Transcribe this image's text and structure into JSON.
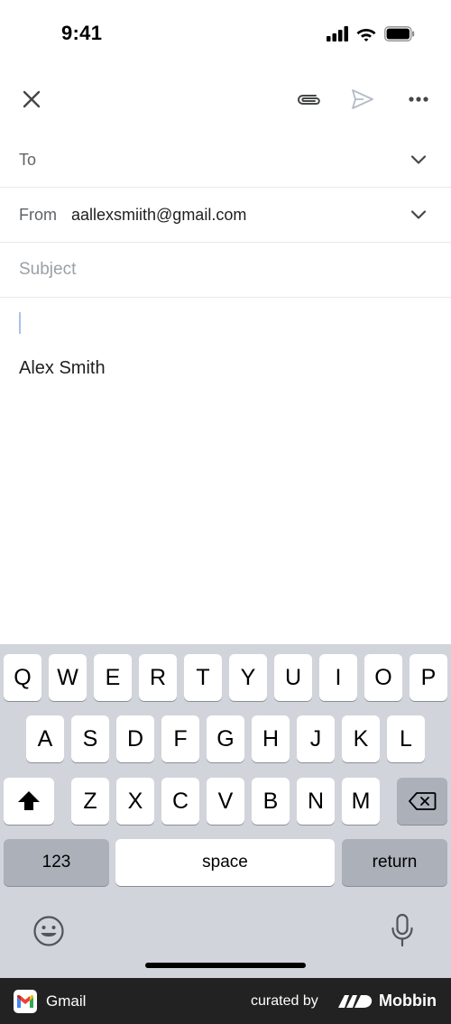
{
  "status_bar": {
    "time": "9:41"
  },
  "compose": {
    "to_label": "To",
    "from_label": "From",
    "from_value": "aallexsmiith@gmail.com",
    "subject_placeholder": "Subject",
    "signature": "Alex Smith"
  },
  "keyboard": {
    "row1": [
      "Q",
      "W",
      "E",
      "R",
      "T",
      "Y",
      "U",
      "I",
      "O",
      "P"
    ],
    "row2": [
      "A",
      "S",
      "D",
      "F",
      "G",
      "H",
      "J",
      "K",
      "L"
    ],
    "row3": [
      "Z",
      "X",
      "C",
      "V",
      "B",
      "N",
      "M"
    ],
    "numbers_label": "123",
    "space_label": "space",
    "return_label": "return"
  },
  "footer": {
    "app_name": "Gmail",
    "curated_by": "curated by",
    "brand": "Mobbin"
  },
  "colors": {
    "accent_caret": "#a8c1ec",
    "keyboard_bg": "#d1d4da",
    "footer_bg": "#222222"
  }
}
